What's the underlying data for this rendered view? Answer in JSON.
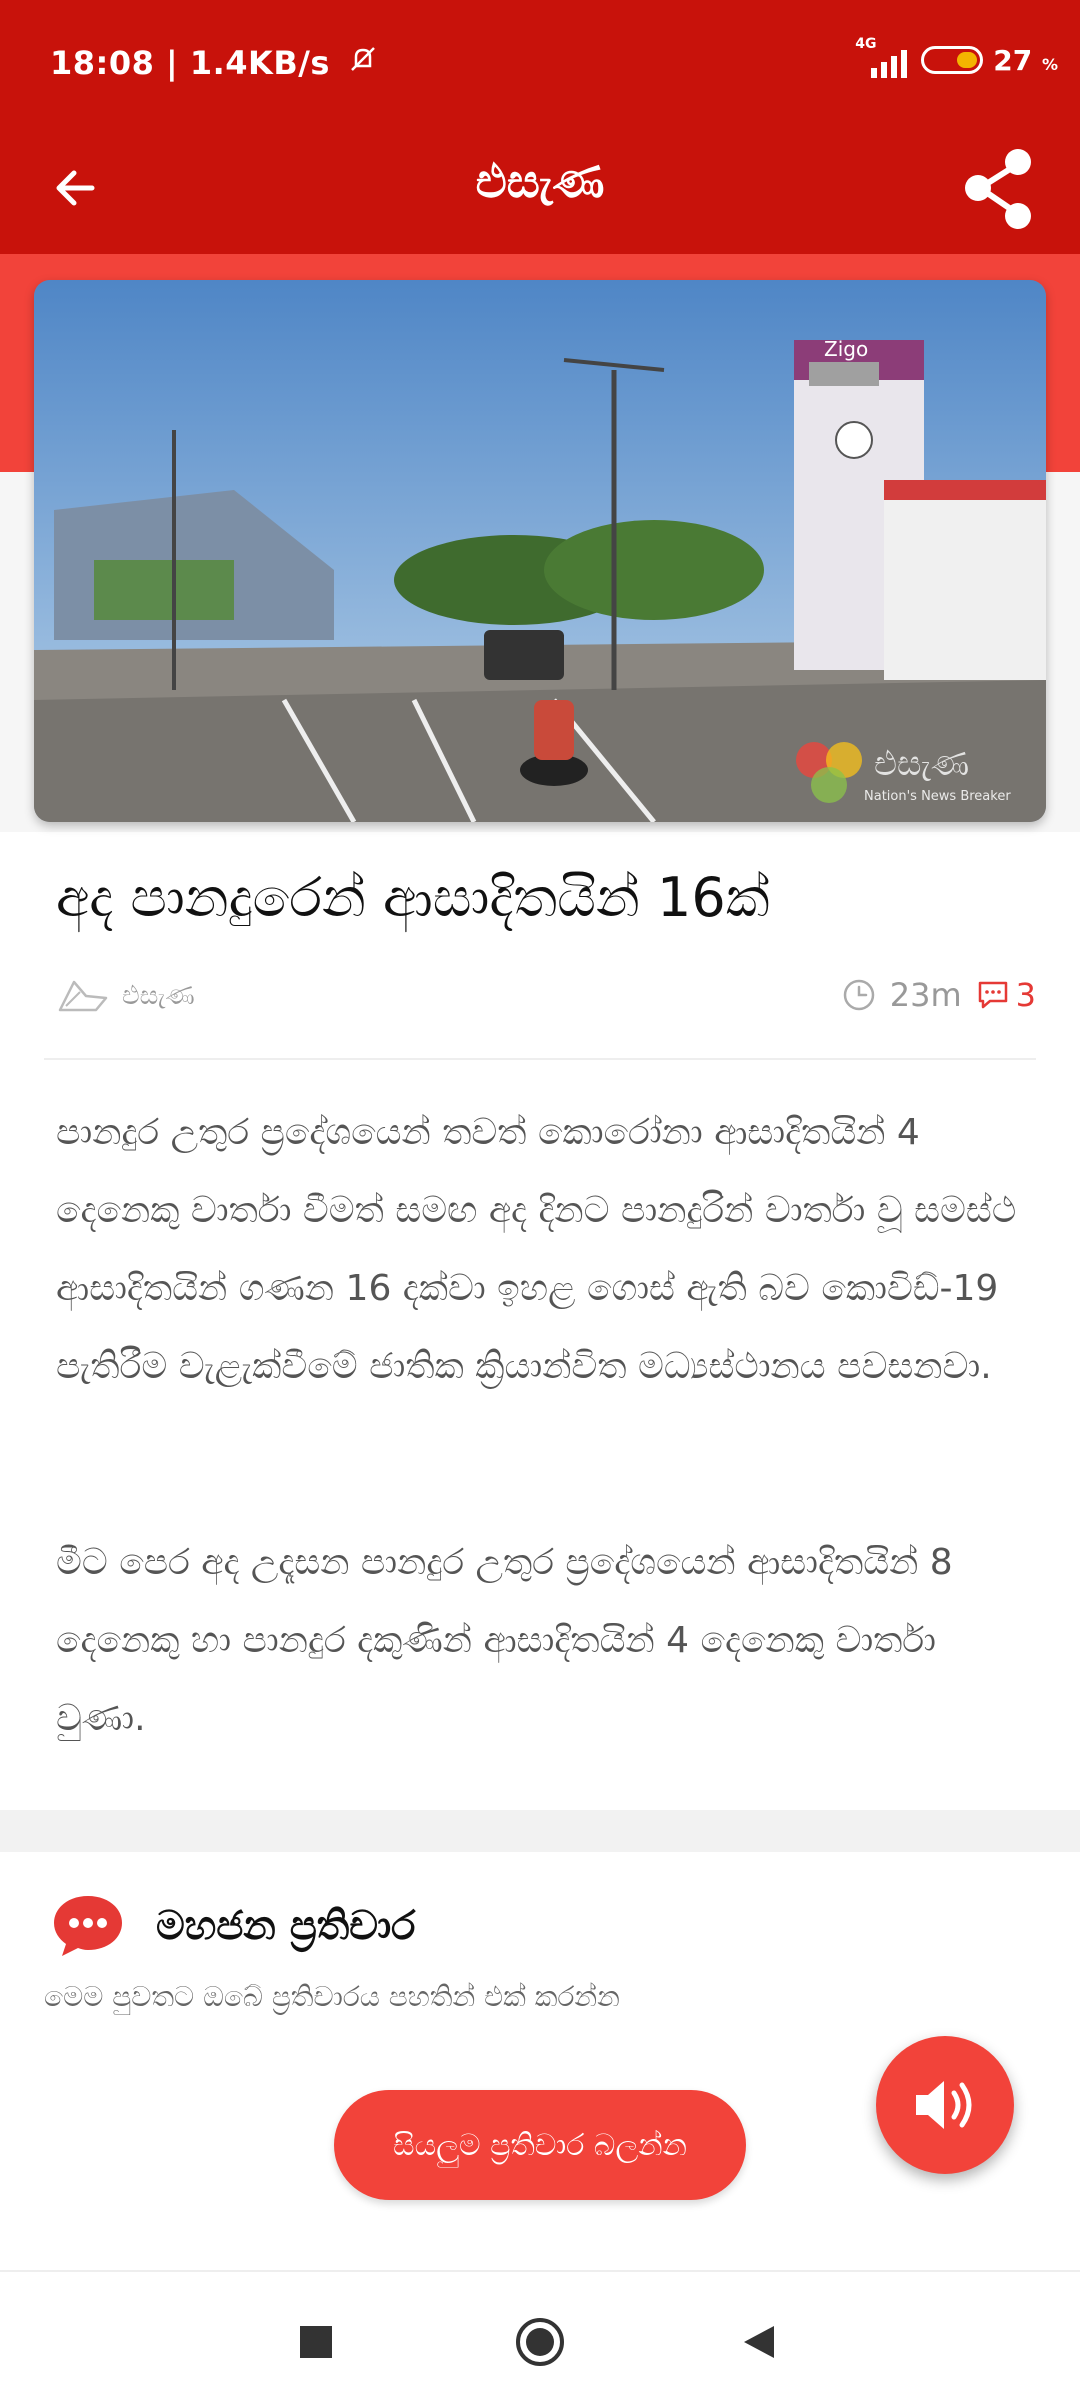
{
  "status_bar": {
    "time": "18:08",
    "speed": "1.4KB/s",
    "network_tag": "4G",
    "battery": "27",
    "battery_unit": "%"
  },
  "app_bar": {
    "title": "එසැණ",
    "back_icon": "arrow-back-icon",
    "share_icon": "share-icon"
  },
  "hero": {
    "watermark": "එසැණ",
    "watermark_sub": "Nation's News Breaker",
    "sign": "Zigo"
  },
  "article": {
    "title": "අද පානදුරෙන් ආසාදිතයින් 16ක්",
    "author": "එසැණ",
    "time_ago": "23m",
    "comment_count": "3",
    "paragraphs": [
      "පානදුර උතුර ප්‍රදේශයෙන් තවත් කොරෝනා ආසාදිතයින් 4 දෙනෙකු වාර්තා වීමත් සමඟ අද දිනට පානදුරින් වාර්තා වූ සමස්ථ ආසාදිතයින් ගණන 16 දක්වා ඉහළ ගොස් ඇති බව කොවිඩ්-19 පැතිරීම වැළැක්වීමේ ජාතික ක්‍රියාන්විත මධ්‍යස්ථානය පවසනවා.",
      "මීට පෙර අද උදෑසන පානදුර උතුර ප්‍රදේශයෙන් ආසාදිතයින් 8 දෙනෙකු හා පානදුර දකුණින් ආසාදිතයින් 4 දෙනෙකු වාර්තා වුණා."
    ]
  },
  "comments": {
    "title": "මහජන ප්‍රතිචාර",
    "subtitle": "මෙම පුවතට ඔබේ ප්‍රතිචාරය පහතින් එක් කරන්න",
    "view_all_label": "සියලුම ප්‍රතිචාර බලන්න"
  },
  "colors": {
    "primary": "#c8120b",
    "accent": "#f2433a"
  }
}
